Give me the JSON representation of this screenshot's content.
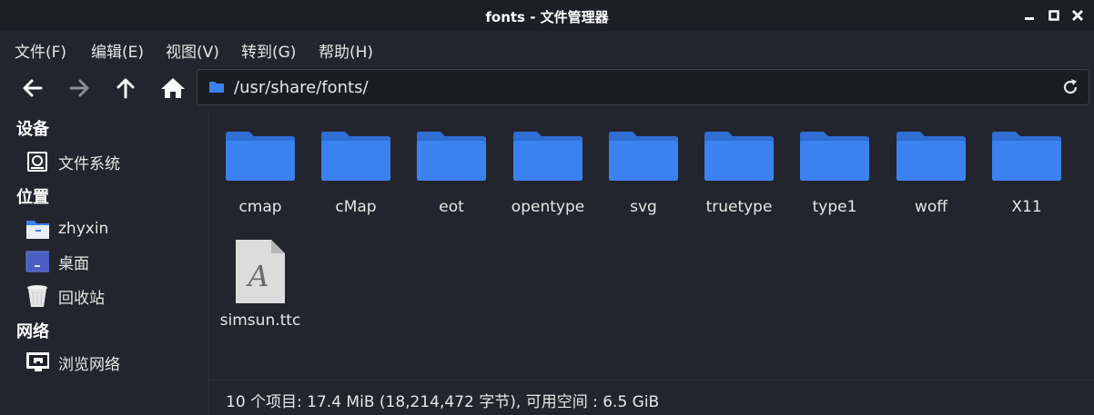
{
  "window": {
    "title": "fonts - 文件管理器"
  },
  "menu": [
    "文件(F)",
    "编辑(E)",
    "视图(V)",
    "转到(G)",
    "帮助(H)"
  ],
  "location": {
    "path": "/usr/share/fonts/"
  },
  "sidebar": {
    "sections": [
      {
        "title": "设备",
        "items": [
          {
            "label": "文件系统",
            "icon": "drive-icon"
          }
        ]
      },
      {
        "title": "位置",
        "items": [
          {
            "label": "zhyxin",
            "icon": "home-folder-icon"
          },
          {
            "label": "桌面",
            "icon": "desktop-icon"
          },
          {
            "label": "回收站",
            "icon": "trash-icon"
          }
        ]
      },
      {
        "title": "网络",
        "items": [
          {
            "label": "浏览网络",
            "icon": "network-icon"
          }
        ]
      }
    ]
  },
  "files": [
    {
      "name": "cmap",
      "type": "folder"
    },
    {
      "name": "cMap",
      "type": "folder"
    },
    {
      "name": "eot",
      "type": "folder"
    },
    {
      "name": "opentype",
      "type": "folder"
    },
    {
      "name": "svg",
      "type": "folder"
    },
    {
      "name": "truetype",
      "type": "folder"
    },
    {
      "name": "type1",
      "type": "folder"
    },
    {
      "name": "woff",
      "type": "folder"
    },
    {
      "name": "X11",
      "type": "folder"
    },
    {
      "name": "simsun.ttc",
      "type": "font",
      "glyph": "A"
    }
  ],
  "status": {
    "text": "10 个项目: 17.4 MiB (18,214,472 字节), 可用空间 : 6.5 GiB"
  },
  "colors": {
    "folder": "#3b82f0",
    "background": "#23252e",
    "titlebar": "#1d1f26"
  }
}
